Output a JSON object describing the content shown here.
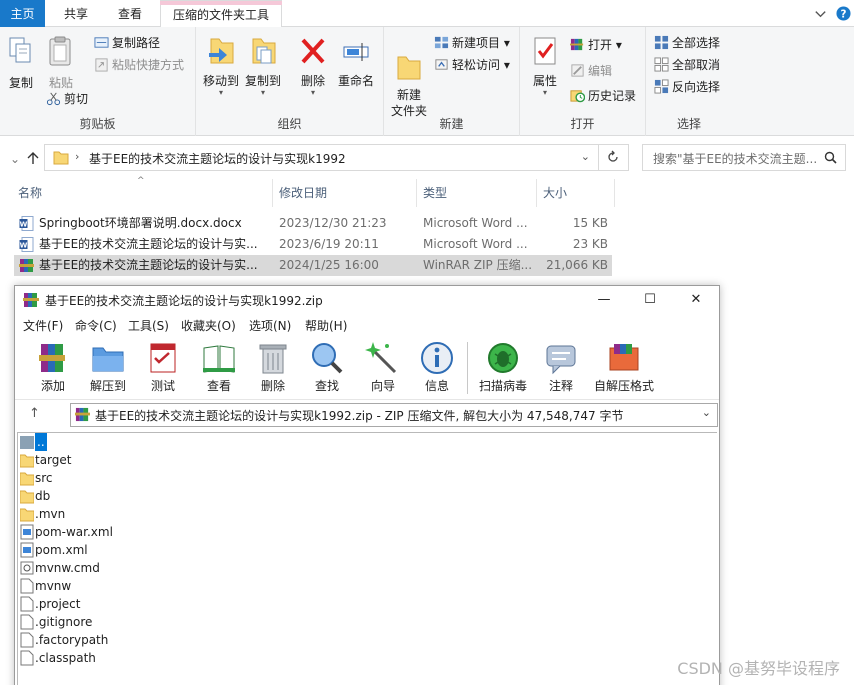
{
  "explorer": {
    "tabs": [
      "主页",
      "共享",
      "查看",
      "压缩的文件夹工具"
    ],
    "ribbon": {
      "clipboard": {
        "label": "剪贴板",
        "copy": "复制",
        "paste": "粘贴",
        "copy_path": "复制路径",
        "paste_shortcut": "粘贴快捷方式",
        "cut": "剪切"
      },
      "organize": {
        "label": "组织",
        "move_to": "移动到",
        "copy_to": "复制到",
        "delete": "删除",
        "rename": "重命名"
      },
      "new": {
        "label": "新建",
        "new_folder": "新建\n文件夹",
        "new_item": "新建项目",
        "easy_access": "轻松访问"
      },
      "open": {
        "label": "打开",
        "properties": "属性",
        "open": "打开",
        "edit": "编辑",
        "history": "历史记录"
      },
      "select": {
        "label": "选择",
        "select_all": "全部选择",
        "select_none": "全部取消",
        "invert": "反向选择"
      }
    },
    "address": "基于EE的技术交流主题论坛的设计与实现k1992",
    "search_placeholder": "搜索\"基于EE的技术交流主题...",
    "columns": [
      "名称",
      "修改日期",
      "类型",
      "大小"
    ],
    "files": [
      {
        "name": "Springboot环境部署说明.docx.docx",
        "date": "2023/12/30 21:23",
        "type": "Microsoft Word ...",
        "size": "15 KB",
        "icon": "word-icon"
      },
      {
        "name": "基于EE的技术交流主题论坛的设计与实...",
        "date": "2023/6/19 20:11",
        "type": "Microsoft Word ...",
        "size": "23 KB",
        "icon": "word-icon"
      },
      {
        "name": "基于EE的技术交流主题论坛的设计与实...",
        "date": "2024/1/25 16:00",
        "type": "WinRAR ZIP 压缩...",
        "size": "21,066 KB",
        "icon": "winrar-icon"
      }
    ]
  },
  "winrar": {
    "title": "基于EE的技术交流主题论坛的设计与实现k1992.zip",
    "menu": [
      "文件(F)",
      "命令(C)",
      "工具(S)",
      "收藏夹(O)",
      "选项(N)",
      "帮助(H)"
    ],
    "toolbar": [
      "添加",
      "解压到",
      "测试",
      "查看",
      "删除",
      "查找",
      "向导",
      "信息",
      "扫描病毒",
      "注释",
      "自解压格式"
    ],
    "path": "基于EE的技术交流主题论坛的设计与实现k1992.zip - ZIP 压缩文件, 解包大小为 47,548,747 字节",
    "entries": [
      {
        "name": "..",
        "kind": "parent"
      },
      {
        "name": "target",
        "kind": "folder"
      },
      {
        "name": "src",
        "kind": "folder"
      },
      {
        "name": "db",
        "kind": "folder"
      },
      {
        "name": ".mvn",
        "kind": "folder"
      },
      {
        "name": "pom-war.xml",
        "kind": "xml"
      },
      {
        "name": "pom.xml",
        "kind": "xml"
      },
      {
        "name": "mvnw.cmd",
        "kind": "cmd"
      },
      {
        "name": "mvnw",
        "kind": "file"
      },
      {
        "name": ".project",
        "kind": "file"
      },
      {
        "name": ".gitignore",
        "kind": "file"
      },
      {
        "name": ".factorypath",
        "kind": "file"
      },
      {
        "name": ".classpath",
        "kind": "file"
      }
    ]
  },
  "watermark": "CSDN @基努毕设程序",
  "colors": {
    "accent": "#1979ca",
    "selected_row": "#d9d9d9",
    "winrar_selection": "#0078d7"
  }
}
